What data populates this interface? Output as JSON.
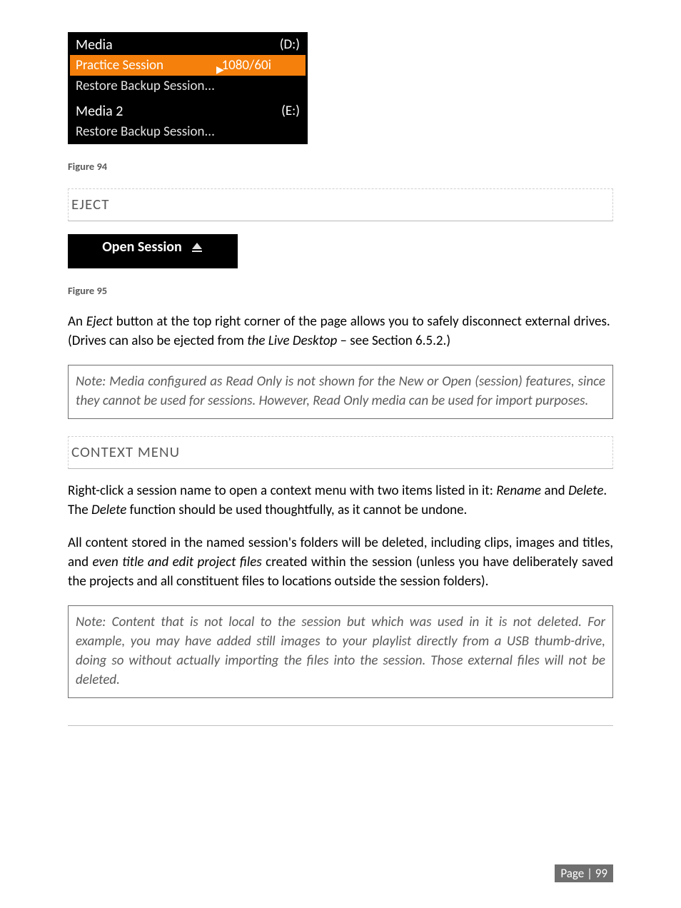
{
  "figure94": {
    "caption": "Figure 94",
    "panel1": {
      "title": "Media",
      "drive": "(D:)",
      "highlight_left": "Practice Session",
      "highlight_right": "1080/60i",
      "restore": "Restore Backup Session..."
    },
    "panel2": {
      "title": "Media 2",
      "drive": "(E:)",
      "restore": "Restore Backup Session..."
    }
  },
  "eject_section": {
    "heading": "EJECT"
  },
  "figure95": {
    "caption": "Figure 95",
    "open_session": "Open Session"
  },
  "para1": "An Eject button at the top right corner of the page allows you to safely disconnect external drives.  (Drives can also be ejected from the Live Desktop – see Section 6.5.2.)",
  "note1": "Note: Media configured as Read Only is not shown for the New or Open (session) features, since they cannot be used for sessions.  However, Read Only media can be used for import purposes.",
  "context_section": {
    "heading": "CONTEXT MENU"
  },
  "para2": "Right-click a session name to open a context menu with two items listed in it: Rename and Delete.   The Delete function should be used thoughtfully, as it cannot be undone.",
  "para3": "All content stored in the named session's folders will be deleted, including clips, images and titles, and even title and edit project files created within the session (unless you have deliberately saved the projects and all constituent files to locations outside the session folders).",
  "note2": "Note: Content that is not local to the session but which was used in it is not deleted.  For example, you may have added still images to your playlist directly from a USB thumb-drive, doing so without actually importing the files into the session. Those external files will not be deleted.",
  "footer": "Page | 99"
}
